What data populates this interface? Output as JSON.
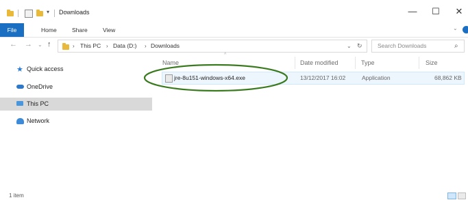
{
  "window": {
    "title": "Downloads",
    "quick_access_icons": [
      "folder-icon",
      "properties-icon",
      "new-folder-icon",
      "customize-arrow-icon"
    ],
    "controls": {
      "minimize": "—",
      "maximize": "☐",
      "close": "✕"
    }
  },
  "ribbon": {
    "tabs": [
      "File",
      "Home",
      "Share",
      "View"
    ],
    "accent": "#1a6fc2"
  },
  "address": {
    "crumbs": [
      "This PC",
      "Data (D:)",
      "Downloads"
    ],
    "search_placeholder": "Search Downloads"
  },
  "nav": {
    "items": [
      {
        "label": "Quick access",
        "icon": "star-icon"
      },
      {
        "label": "OneDrive",
        "icon": "cloud-icon"
      },
      {
        "label": "This PC",
        "icon": "computer-icon",
        "selected": true
      },
      {
        "label": "Network",
        "icon": "network-icon"
      }
    ]
  },
  "columns": {
    "name": "Name",
    "date": "Date modified",
    "type": "Type",
    "size": "Size"
  },
  "files": [
    {
      "name": "jre-8u151-windows-x64.exe",
      "date": "13/12/2017 16:02",
      "type": "Application",
      "size": "68,862 KB",
      "icon": "installer-icon",
      "highlighted": true
    }
  ],
  "annotation": {
    "color": "#3a7a1e"
  },
  "status": {
    "count": "1 item"
  }
}
